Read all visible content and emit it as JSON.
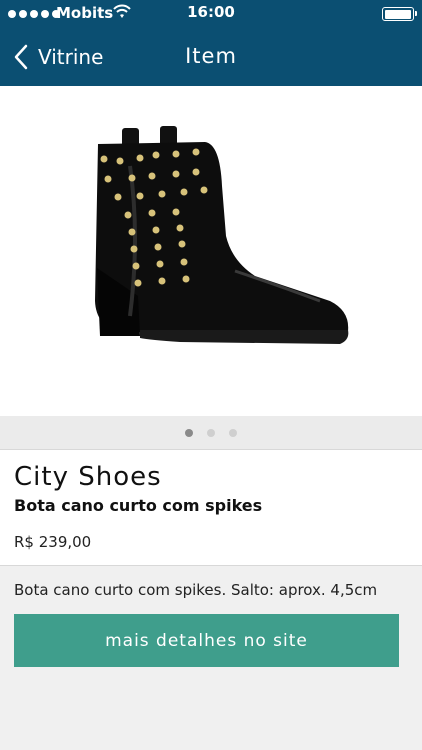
{
  "status_bar": {
    "carrier": "Mobits",
    "time": "16:00",
    "battery_level": 0.95
  },
  "nav": {
    "back_label": "Vitrine",
    "title": "Item"
  },
  "product": {
    "image_icon": "boot-with-spikes-image",
    "pager": {
      "count": 3,
      "active": 1
    },
    "brand": "City Shoes",
    "name": "Bota cano curto com spikes",
    "price": "R$ 239,00",
    "description": "Bota cano curto com spikes. Salto: aprox. 4,5cm"
  },
  "cta": {
    "label": "mais detalhes no site"
  },
  "colors": {
    "nav_bar": "#0b4f72",
    "cta": "#3f9e8c",
    "background": "#f0f0f0"
  }
}
